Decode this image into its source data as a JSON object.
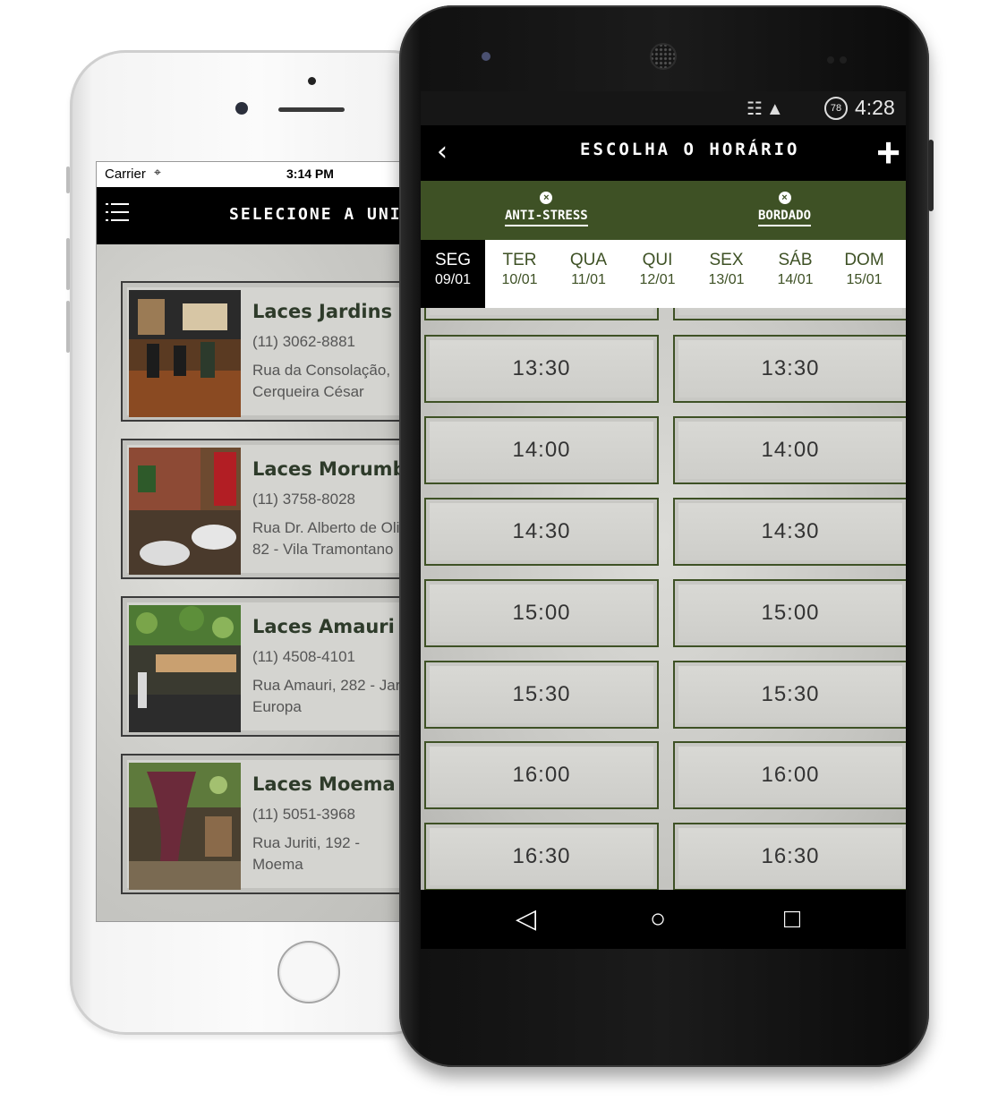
{
  "ios": {
    "status": {
      "carrier": "Carrier",
      "wifi": "wifi-icon",
      "time": "3:14 PM"
    },
    "nav": {
      "title": "SELECIONE A UNIDADE",
      "menu_icon": "menu-icon"
    },
    "units": [
      {
        "name": "Laces Jardins",
        "phone": "(11) 3062-8881",
        "address_line1": "Rua da Consolação,",
        "address_line2": "Cerqueira César"
      },
      {
        "name": "Laces Morumbi",
        "phone": "(11) 3758-8028",
        "address_line1": "Rua Dr. Alberto de Oli",
        "address_line2": "82 - Vila Tramontano"
      },
      {
        "name": "Laces Amauri",
        "phone": "(11) 4508-4101",
        "address_line1": "Rua Amauri, 282 - Jar",
        "address_line2": "Europa"
      },
      {
        "name": "Laces Moema",
        "phone": "(11) 5051-3968",
        "address_line1": "Rua Juriti, 192 -",
        "address_line2": "Moema"
      }
    ]
  },
  "android": {
    "status": {
      "battery": "78",
      "time": "4:28"
    },
    "nav": {
      "back_icon": "chevron-left-icon",
      "title": "ESCOLHA O HORÁRIO",
      "add_icon": "plus-icon"
    },
    "filters": [
      {
        "label": "ANTI-STRESS",
        "remove_icon": "close-icon"
      },
      {
        "label": "BORDADO",
        "remove_icon": "close-icon"
      }
    ],
    "days": [
      {
        "name": "SEG",
        "date": "09/01",
        "active": true
      },
      {
        "name": "TER",
        "date": "10/01",
        "active": false
      },
      {
        "name": "QUA",
        "date": "11/01",
        "active": false
      },
      {
        "name": "QUI",
        "date": "12/01",
        "active": false
      },
      {
        "name": "SEX",
        "date": "13/01",
        "active": false
      },
      {
        "name": "SÁB",
        "date": "14/01",
        "active": false
      },
      {
        "name": "DOM",
        "date": "15/01",
        "active": false
      }
    ],
    "slots_left": [
      "13:30",
      "14:00",
      "14:30",
      "15:00",
      "15:30",
      "16:00",
      "16:30"
    ],
    "slots_right": [
      "13:30",
      "14:00",
      "14:30",
      "15:00",
      "15:30",
      "16:00",
      "16:30"
    ],
    "softkeys": [
      "back-icon",
      "home-icon",
      "recents-icon"
    ],
    "colors": {
      "accent": "#3e5125",
      "bar": "#000000"
    }
  }
}
